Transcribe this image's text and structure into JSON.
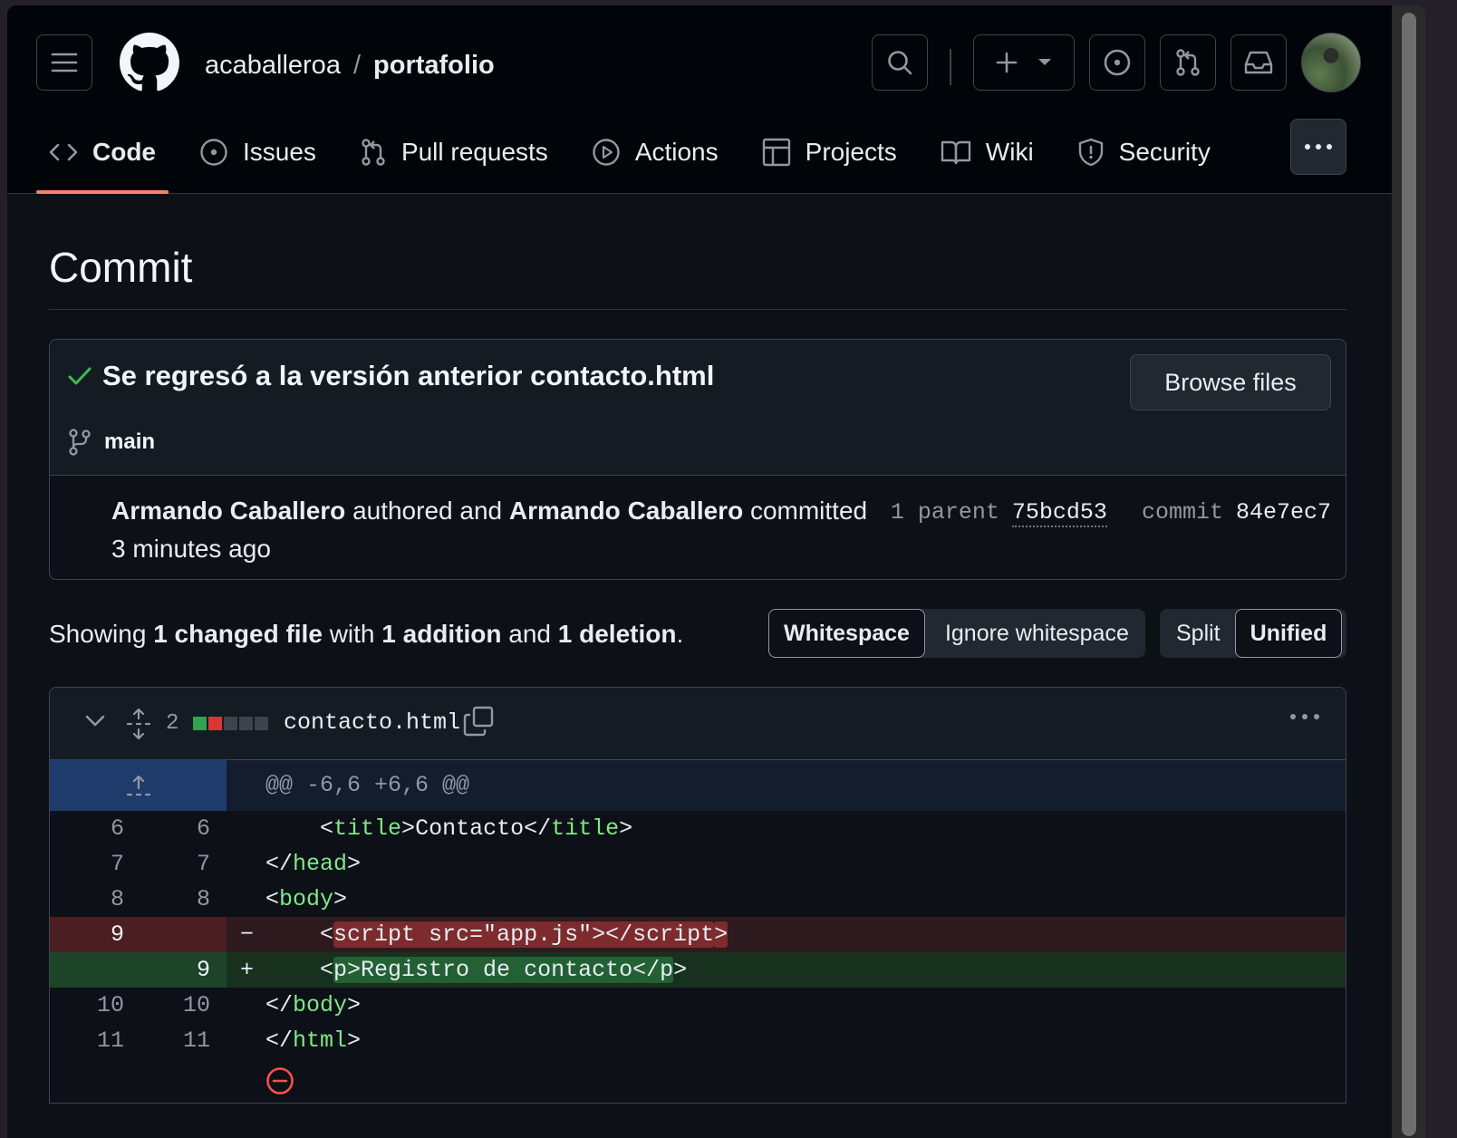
{
  "header": {
    "owner": "acaballeroa",
    "separator": "/",
    "repo": "portafolio"
  },
  "tabs": [
    {
      "label": "Code",
      "icon": "code-icon",
      "selected": true
    },
    {
      "label": "Issues",
      "icon": "issue-icon"
    },
    {
      "label": "Pull requests",
      "icon": "pull-request-icon"
    },
    {
      "label": "Actions",
      "icon": "play-icon"
    },
    {
      "label": "Projects",
      "icon": "table-icon"
    },
    {
      "label": "Wiki",
      "icon": "book-icon"
    },
    {
      "label": "Security",
      "icon": "shield-icon"
    }
  ],
  "page": {
    "title": "Commit"
  },
  "commit": {
    "message": "Se regresó a la versión anterior contacto.html",
    "browse_label": "Browse files",
    "branch": "main",
    "author": "Armando Caballero",
    "authored_text": "authored and",
    "committer": "Armando Caballero",
    "committed_text": "committed",
    "time": "3 minutes ago",
    "parent_label": "1 parent",
    "parent_sha": "75bcd53",
    "commit_label": "commit",
    "commit_sha": "84e7ec7"
  },
  "summary": {
    "showing": "Showing",
    "files": "1 changed file",
    "with": "with",
    "additions": "1 addition",
    "and": "and",
    "deletions": "1 deletion",
    "period": "."
  },
  "toggles": {
    "whitespace": "Whitespace",
    "ignore_whitespace": "Ignore whitespace",
    "split": "Split",
    "unified": "Unified"
  },
  "diff": {
    "change_count": "2",
    "filename": "contacto.html",
    "hunk": "@@ -6,6 +6,6 @@",
    "colors": {
      "added": "#2da44e",
      "deleted": "#da3633",
      "neutral": "#3d444d"
    },
    "lines": [
      {
        "old": "6",
        "new": "6",
        "type": "ctx"
      },
      {
        "old": "7",
        "new": "7",
        "type": "ctx"
      },
      {
        "old": "8",
        "new": "8",
        "type": "ctx"
      },
      {
        "old": "9",
        "new": "",
        "type": "del",
        "sign": "−"
      },
      {
        "old": "",
        "new": "9",
        "type": "add",
        "sign": "+"
      },
      {
        "old": "10",
        "new": "10",
        "type": "ctx"
      },
      {
        "old": "11",
        "new": "11",
        "type": "ctx"
      }
    ],
    "code": {
      "l6": {
        "indent": "    ",
        "lt": "<",
        "tag": "title",
        "gt": ">",
        "text": "Contacto",
        "close_lt": "</",
        "close_tag": "title",
        "close_gt": ">"
      },
      "l7": {
        "lt": "</",
        "tag": "head",
        "gt": ">"
      },
      "l8": {
        "lt": "<",
        "tag": "body",
        "gt": ">"
      },
      "l9del": {
        "indent": "    ",
        "lt": "<",
        "content": "script src=\"app.js\"></script",
        "gt": ">"
      },
      "l9add": {
        "indent": "    ",
        "lt": "<",
        "content": "p>Registro de contacto</p",
        "gt": ">"
      },
      "l10": {
        "lt": "</",
        "tag": "body",
        "gt": ">"
      },
      "l11": {
        "lt": "</",
        "tag": "html",
        "gt": ">"
      }
    }
  }
}
